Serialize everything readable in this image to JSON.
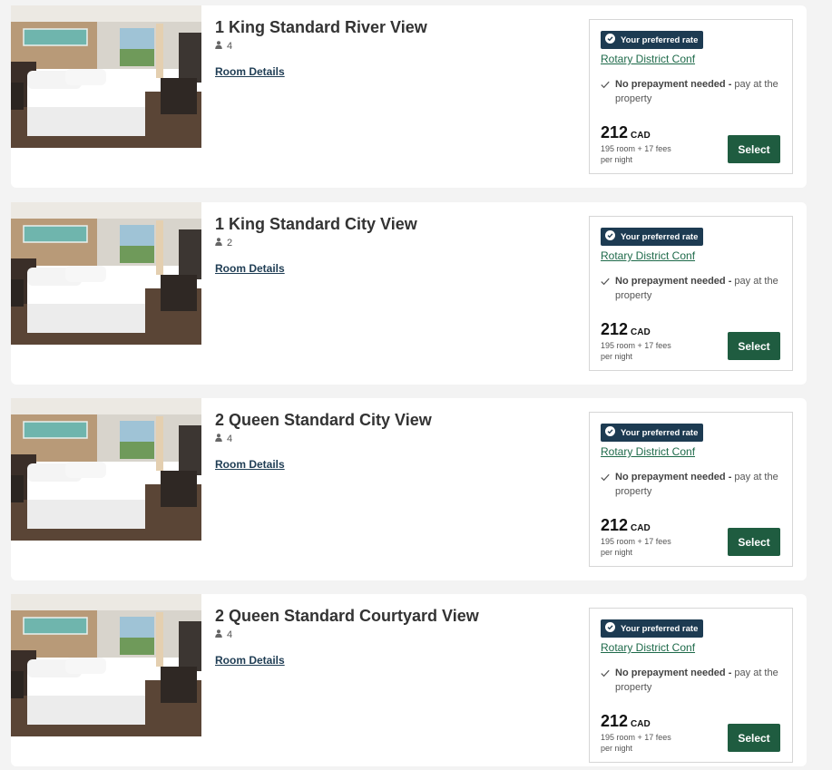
{
  "colors": {
    "badge_bg": "#1d3b52",
    "link_green": "#1e6a4a",
    "select_button_bg": "#1f5c40",
    "room_details_link": "#1f3d54"
  },
  "icons": {
    "guests": "person-icon",
    "badge": "check-circle-icon",
    "prepayment": "checkmark-icon"
  },
  "rooms": [
    {
      "name": "1 King Standard River View",
      "guests": "4",
      "details_label": "Room Details",
      "badge": "Your preferred rate",
      "rate_name": "Rotary District Conf",
      "prepay_bold": "No prepayment needed -",
      "prepay_rest": " pay at the property",
      "price": "212",
      "currency": "CAD",
      "breakdown": "195 room + 17 fees",
      "per_night": "per night",
      "select_label": "Select"
    },
    {
      "name": "1 King Standard City View",
      "guests": "2",
      "details_label": "Room Details",
      "badge": "Your preferred rate",
      "rate_name": "Rotary District Conf",
      "prepay_bold": "No prepayment needed -",
      "prepay_rest": " pay at the property",
      "price": "212",
      "currency": "CAD",
      "breakdown": "195 room + 17 fees",
      "per_night": "per night",
      "select_label": "Select"
    },
    {
      "name": "2 Queen Standard City View",
      "guests": "4",
      "details_label": "Room Details",
      "badge": "Your preferred rate",
      "rate_name": "Rotary District Conf",
      "prepay_bold": "No prepayment needed -",
      "prepay_rest": " pay at the property",
      "price": "212",
      "currency": "CAD",
      "breakdown": "195 room + 17 fees",
      "per_night": "per night",
      "select_label": "Select"
    },
    {
      "name": "2 Queen Standard Courtyard View",
      "guests": "4",
      "details_label": "Room Details",
      "badge": "Your preferred rate",
      "rate_name": "Rotary District Conf",
      "prepay_bold": "No prepayment needed -",
      "prepay_rest": " pay at the property",
      "price": "212",
      "currency": "CAD",
      "breakdown": "195 room + 17 fees",
      "per_night": "per night",
      "select_label": "Select"
    }
  ]
}
